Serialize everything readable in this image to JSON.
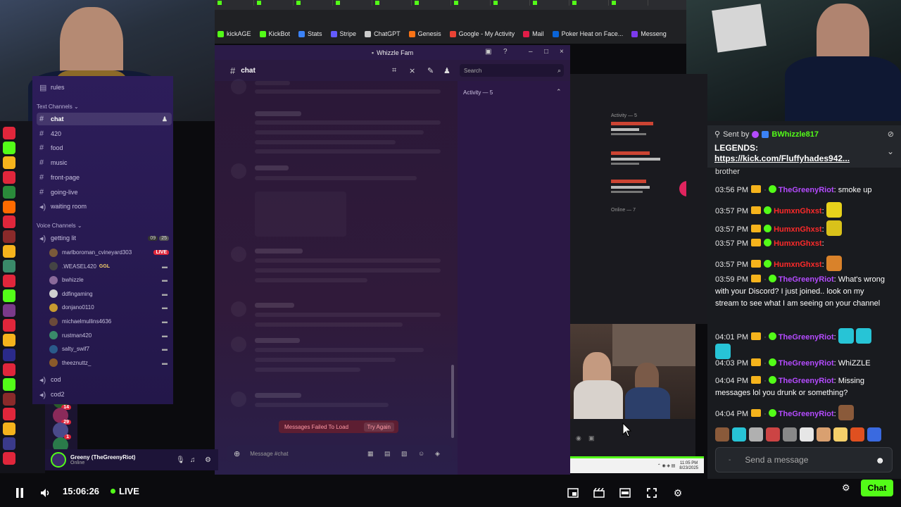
{
  "browser": {
    "bookmarks": [
      {
        "label": "kickAGE",
        "icon": "kick-icon",
        "color": "#53fc18"
      },
      {
        "label": "KickBot",
        "icon": "kick-icon",
        "color": "#53fc18"
      },
      {
        "label": "Stats",
        "icon": "stats-icon",
        "color": "#3b82f6"
      },
      {
        "label": "Stripe",
        "icon": "stripe-icon",
        "color": "#635bff"
      },
      {
        "label": "ChatGPT",
        "icon": "chatgpt-icon",
        "color": "#cccccc"
      },
      {
        "label": "Genesis",
        "icon": "genesis-icon",
        "color": "#f97316"
      },
      {
        "label": "Google - My Activity",
        "icon": "google-icon",
        "color": "#ea4335"
      },
      {
        "label": "Mail",
        "icon": "mail-icon",
        "color": "#e11d48"
      },
      {
        "label": "Poker Heat on Face...",
        "icon": "outlook-icon",
        "color": "#0a64d8"
      },
      {
        "label": "Messeng",
        "icon": "messenger-icon",
        "color": "#7c3aed"
      }
    ]
  },
  "discord": {
    "window_title": "Whizzle Fam",
    "channel_header": "chat",
    "search_placeholder": "Search",
    "activity_label": "Activity — 5",
    "text_channels_label": "Text Channels",
    "voice_channels_label": "Voice Channels",
    "rules_label": "rules",
    "text_channels": [
      "chat",
      "420",
      "food",
      "music",
      "front-page",
      "going-live",
      "waiting room"
    ],
    "voice_channel_main": "getting lit",
    "voice_counts": [
      "09",
      "25"
    ],
    "voice_users": [
      {
        "name": "marlboroman_cvineyard303",
        "live": "LIVE",
        "color": "#7a5a3a"
      },
      {
        "name": ".WEASEL420",
        "tag": "GGL",
        "color": "#444444"
      },
      {
        "name": "bwhizzle",
        "color": "#8a6a9a"
      },
      {
        "name": "ddfingaming",
        "color": "#d0d0d0"
      },
      {
        "name": "donjano0110",
        "color": "#c89a30"
      },
      {
        "name": "michaelmullins4636",
        "color": "#6a4a3a"
      },
      {
        "name": "rustman420",
        "color": "#3a8a6a"
      },
      {
        "name": "salty_swif7",
        "color": "#2a5a8a"
      },
      {
        "name": "theeznuttz_",
        "color": "#8a5a2a"
      }
    ],
    "extra_voice": [
      "cod",
      "cod2"
    ],
    "user_name": "Greeny (TheGreenyRiot)",
    "user_status": "Online",
    "error_text": "Messages Failed To Load",
    "retry_label": "Try Again",
    "message_placeholder": "Message #chat"
  },
  "bg_discord": {
    "activity": "Activity — 5",
    "online": "Online — 7"
  },
  "kick_chat": {
    "pinned_prefix": "Sent by",
    "pinned_user": "BWhizzle817",
    "pinned_title": "LEGENDS:",
    "pinned_link": "https://kick.com/Fluffyhades942...",
    "partial": "brother",
    "messages": [
      {
        "time": "03:56 PM",
        "user": "TheGreenyRiot",
        "color": "#b44bff",
        "text": "smoke up",
        "emotes": []
      },
      {
        "time": "03:57 PM",
        "user": "HumxnGhxst",
        "color": "#ff2a2a",
        "text": "",
        "emotes": [
          "#e8d21b"
        ]
      },
      {
        "time": "03:57 PM",
        "user": "HumxnGhxst",
        "color": "#ff2a2a",
        "text": "",
        "emotes": [
          "#d9c21a"
        ]
      },
      {
        "time": "03:57 PM",
        "user": "HumxnGhxst",
        "color": "#ff2a2a",
        "text": "",
        "emotes": []
      },
      {
        "time": "03:57 PM",
        "user": "HumxnGhxst",
        "color": "#ff2a2a",
        "text": "",
        "emotes": [
          "#d9822a"
        ]
      },
      {
        "time": "03:59 PM",
        "user": "TheGreenyRiot",
        "color": "#b44bff",
        "text": "What's wrong with your Discord? I just joined.. look on my stream to see what I am seeing on your channel",
        "emotes": []
      },
      {
        "time": "04:01 PM",
        "user": "TheGreenyRiot",
        "color": "#b44bff",
        "text": "",
        "emotes": [
          "#27c4d6",
          "#27c4d6",
          "#27c4d6"
        ]
      },
      {
        "time": "04:03 PM",
        "user": "TheGreenyRiot",
        "color": "#b44bff",
        "text": "WhiZZLE",
        "emotes": []
      },
      {
        "time": "04:04 PM",
        "user": "TheGreenyRiot",
        "color": "#b44bff",
        "text": "Missing messages lol you drunk or something?",
        "emotes": []
      },
      {
        "time": "04:04 PM",
        "user": "TheGreenyRiot",
        "color": "#b44bff",
        "text": "",
        "emotes": [
          "#8a5a3a"
        ]
      }
    ],
    "send_placeholder": "Send a message",
    "chat_button": "Chat"
  },
  "player": {
    "timestamp": "15:06:26",
    "live_label": "LIVE"
  },
  "taskbar": {
    "time": "11:05 PM",
    "date": "8/23/2025"
  }
}
